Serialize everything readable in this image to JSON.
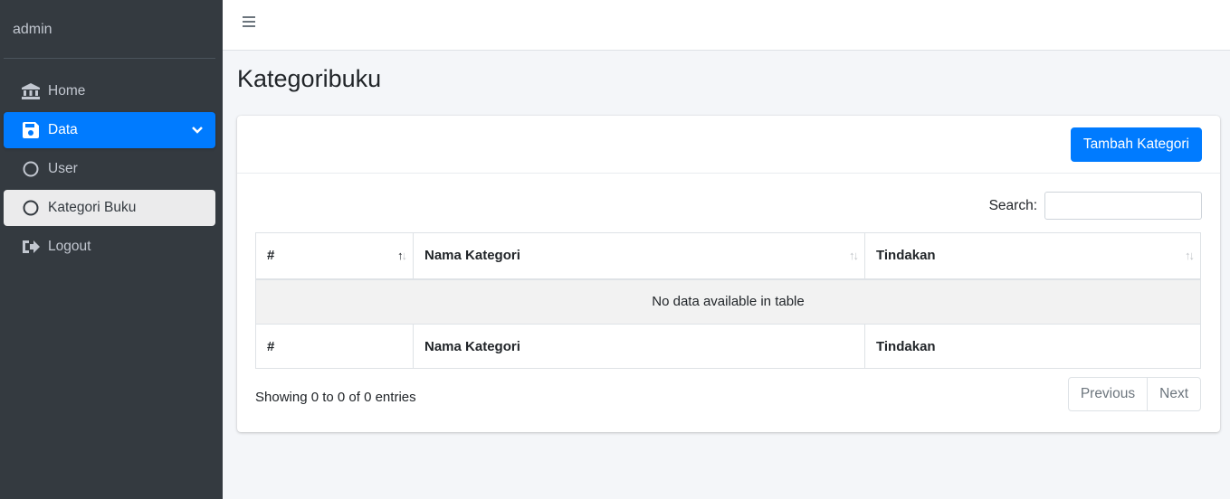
{
  "sidebar": {
    "brand": "admin",
    "items": [
      {
        "label": "Home"
      },
      {
        "label": "Data"
      },
      {
        "label": "User"
      },
      {
        "label": "Kategori Buku"
      },
      {
        "label": "Logout"
      }
    ]
  },
  "page": {
    "title": "Kategoribuku"
  },
  "card": {
    "add_button": "Tambah Kategori",
    "search_label": "Search:",
    "search_value": ""
  },
  "table": {
    "columns": [
      "#",
      "Nama Kategori",
      "Tindakan"
    ],
    "empty_message": "No data available in table",
    "footer": [
      "#",
      "Nama Kategori",
      "Tindakan"
    ]
  },
  "footer": {
    "info": "Showing 0 to 0 of 0 entries",
    "previous": "Previous",
    "next": "Next"
  },
  "colors": {
    "sidebar_bg": "#343a40",
    "primary": "#007bff",
    "page_bg": "#f4f6f9"
  }
}
